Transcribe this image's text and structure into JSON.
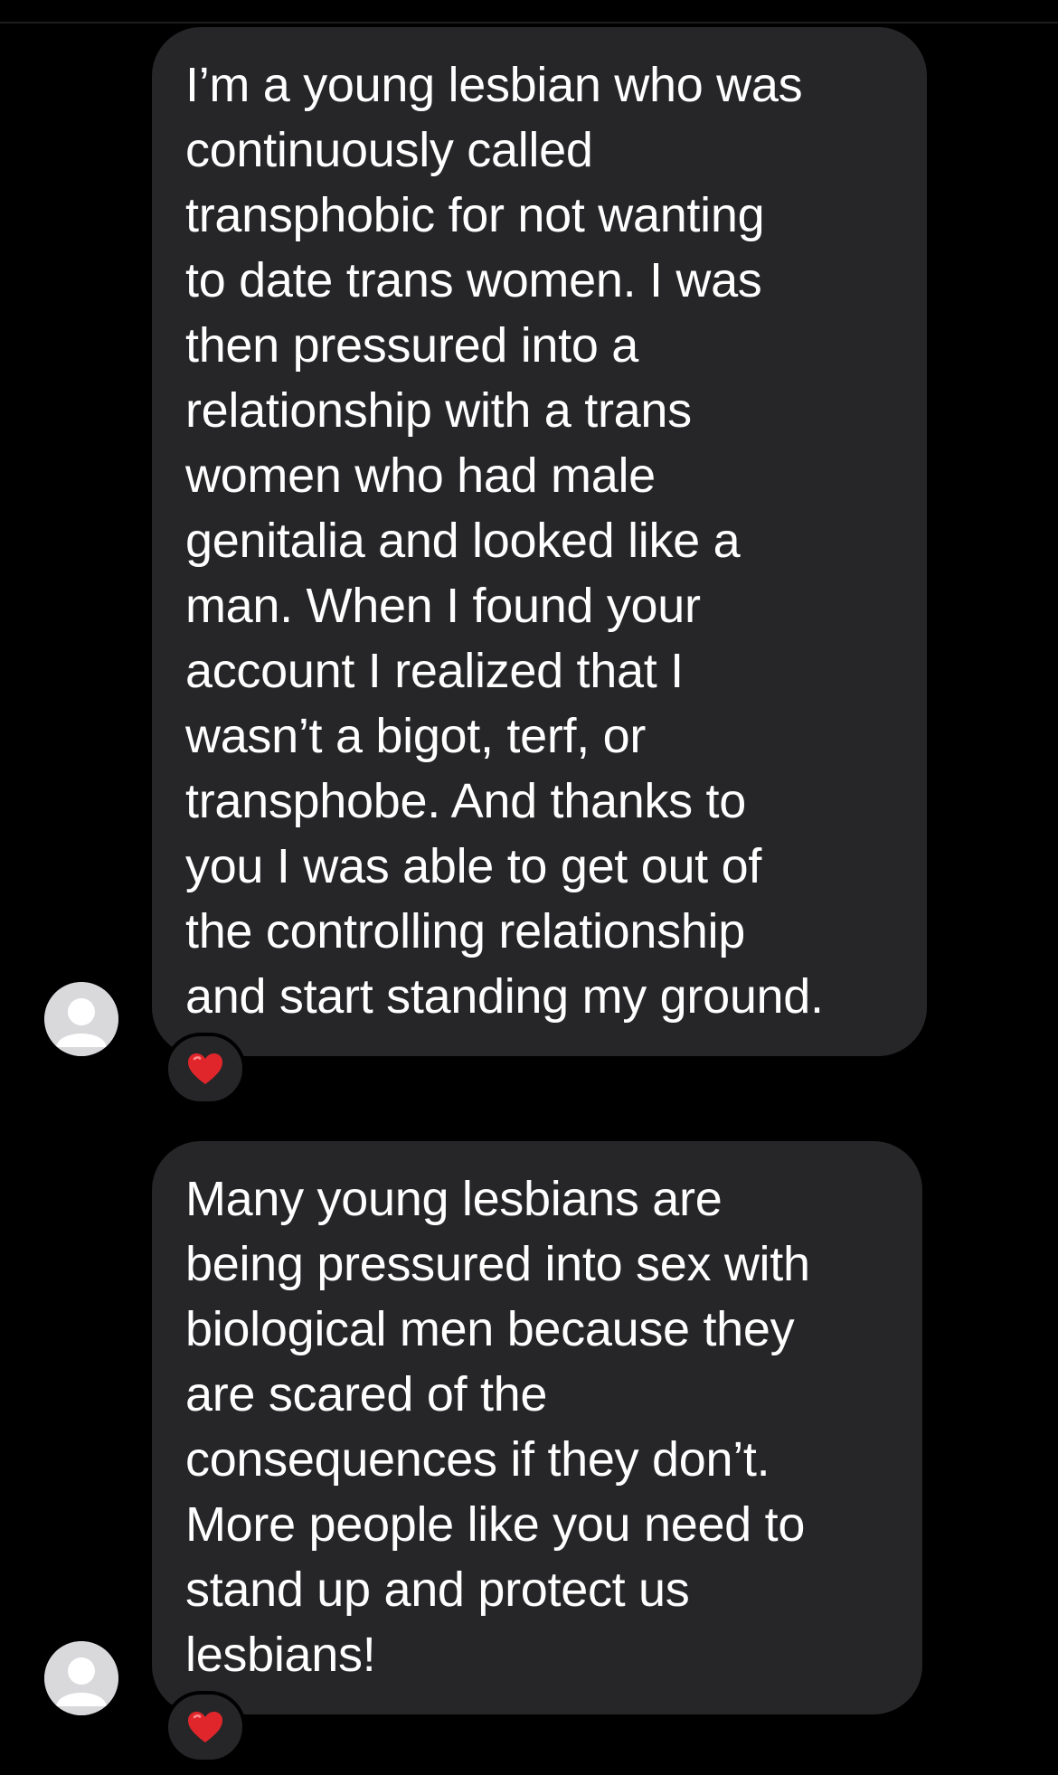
{
  "messages": [
    {
      "text": "I’m a young lesbian who was\ncontinuously called\ntransphobic for not wanting\nto date trans women. I was\nthen pressured into a\nrelationship with a trans\nwomen who had male\ngenitalia and looked like a\nman. When I found your\naccount I realized that I\nwasn’t a bigot, terf, or\ntransphobe. And thanks to\nyou I was able to get out of\nthe controlling relationship\nand start standing my ground.",
      "reaction": "heart-emoji",
      "avatar": "default-avatar-icon"
    },
    {
      "text": "Many young lesbians are\nbeing pressured into sex with\nbiological men because they\nare scared of the\nconsequences if they don’t.\nMore people like you need to\nstand up and protect us\nlesbians!",
      "reaction": "heart-emoji",
      "avatar": "default-avatar-icon"
    }
  ],
  "colors": {
    "background": "#000000",
    "bubble": "#262628",
    "text": "#ffffff",
    "avatar": "#d9d9dc",
    "heart": "#e0262b"
  }
}
